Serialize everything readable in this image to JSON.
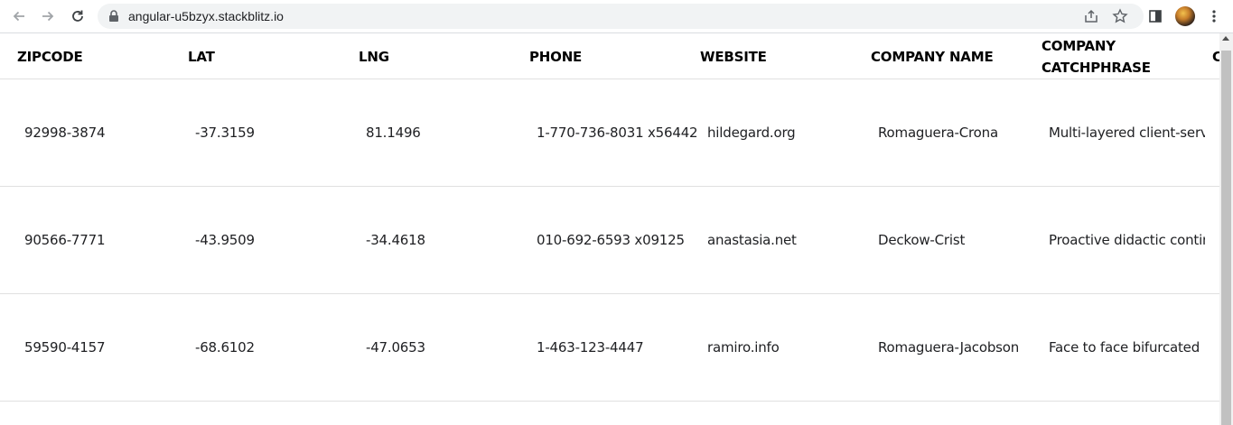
{
  "browser": {
    "url": "angular-u5bzyx.stackblitz.io"
  },
  "table": {
    "headers": {
      "zipcode": "ZIPCODE",
      "lat": "LAT",
      "lng": "LNG",
      "phone": "PHONE",
      "website": "WEBSITE",
      "company_name": "COMPANY NAME",
      "catchphrase_line1": "COMPANY",
      "catchphrase_line2": "CATCHPHRASE",
      "next_col": "C"
    },
    "rows": [
      {
        "zipcode": "92998-3874",
        "lat": "-37.3159",
        "lng": "81.1496",
        "phone": "1-770-736-8031 x56442",
        "website": "hildegard.org",
        "company_name": "Romaguera-Crona",
        "catchphrase": "Multi-layered client-serv"
      },
      {
        "zipcode": "90566-7771",
        "lat": "-43.9509",
        "lng": "-34.4618",
        "phone": "010-692-6593 x09125",
        "website": "anastasia.net",
        "company_name": "Deckow-Crist",
        "catchphrase": "Proactive didactic contin"
      },
      {
        "zipcode": "59590-4157",
        "lat": "-68.6102",
        "lng": "-47.0653",
        "phone": "1-463-123-4447",
        "website": "ramiro.info",
        "company_name": "Romaguera-Jacobson",
        "catchphrase": "Face to face bifurcated ir"
      }
    ]
  }
}
